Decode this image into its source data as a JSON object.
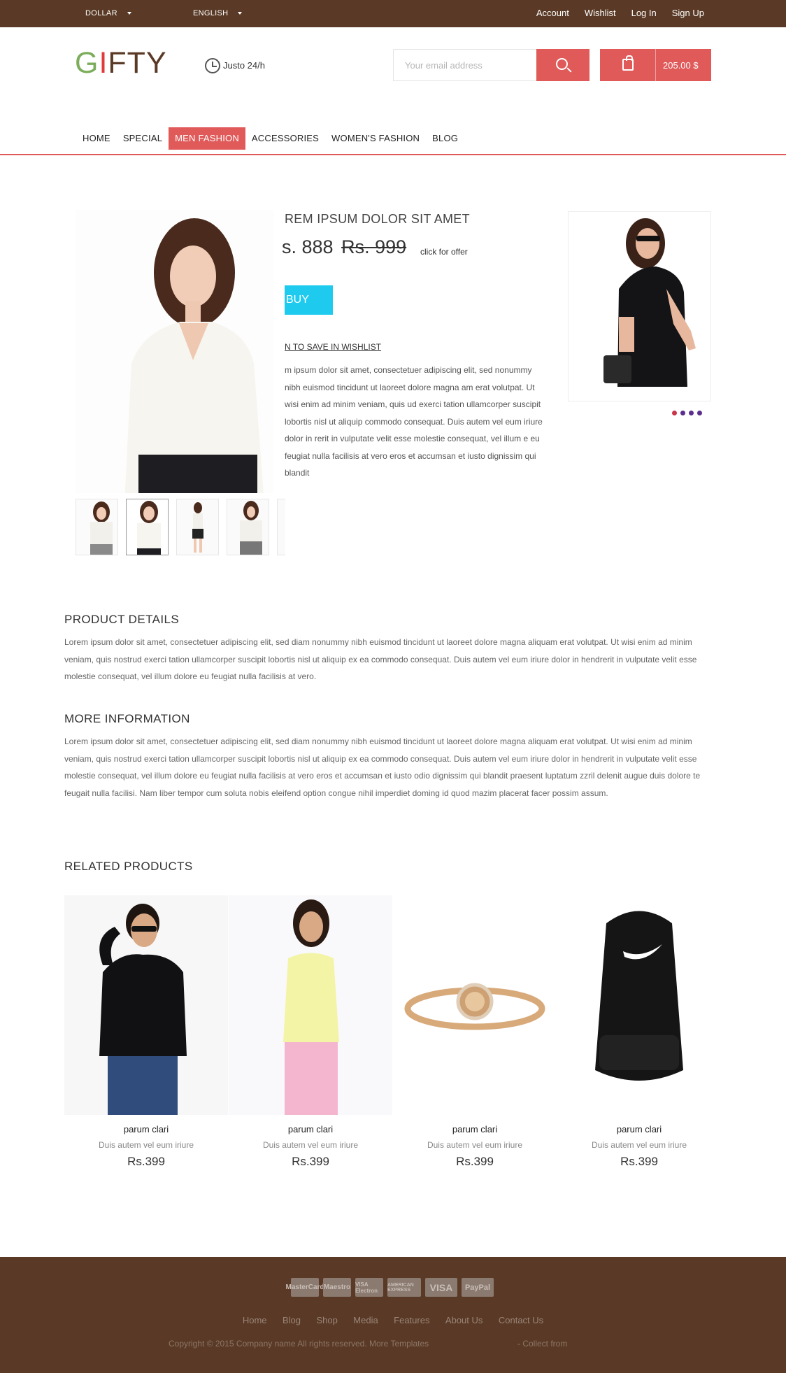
{
  "topbar": {
    "currency": "DOLLAR",
    "language": "ENGLISH",
    "links": [
      "Account",
      "Wishlist",
      "Log In",
      "Sign Up"
    ]
  },
  "header": {
    "logo_g": "G",
    "logo_i": "I",
    "logo_rest": "FTY",
    "support": "Justo 24/h",
    "email_placeholder": "Your email address",
    "cart_total": "205.00 $"
  },
  "nav": [
    "HOME",
    "SPECIAL",
    "MEN FASHION",
    "ACCESSORIES",
    "WOMEN'S FASHION",
    "BLOG"
  ],
  "nav_active": "MEN FASHION",
  "product": {
    "title": "REM IPSUM DOLOR SIT AMET",
    "price": "s. 888",
    "old_price": "Rs. 999",
    "offer": "click for offer",
    "buy": "BUY",
    "wishlist": "N TO SAVE IN WISHLIST",
    "description": "m ipsum dolor sit amet, consectetuer adipiscing elit, sed nonummy nibh euismod tincidunt ut laoreet dolore magna am erat volutpat. Ut wisi enim ad minim veniam, quis ud exerci tation ullamcorper suscipit lobortis nisl ut aliquip commodo consequat. Duis autem vel eum iriure dolor in rerit in vulputate velit esse molestie consequat, vel illum e eu feugiat nulla facilisis at vero eros et accumsan et iusto dignissim qui blandit"
  },
  "carousel_dot_colors": [
    "#c8344a",
    "#5b2d8e",
    "#5b2d8e",
    "#5b2d8e"
  ],
  "details": {
    "title": "PRODUCT DETAILS",
    "text": "Lorem ipsum dolor sit amet, consectetuer adipiscing elit, sed diam nonummy nibh euismod tincidunt ut laoreet dolore magna aliquam erat volutpat. Ut wisi enim ad minim veniam, quis nostrud exerci tation ullamcorper suscipit lobortis nisl ut aliquip ex ea commodo consequat. Duis autem vel eum iriure dolor in hendrerit in vulputate velit esse molestie consequat, vel illum dolore eu feugiat nulla facilisis at vero."
  },
  "more": {
    "title": "MORE INFORMATION",
    "text": "Lorem ipsum dolor sit amet, consectetuer adipiscing elit, sed diam nonummy nibh euismod tincidunt ut laoreet dolore magna aliquam erat volutpat. Ut wisi enim ad minim veniam, quis nostrud exerci tation ullamcorper suscipit lobortis nisl ut aliquip ex ea commodo consequat. Duis autem vel eum iriure dolor in hendrerit in vulputate velit esse molestie consequat, vel illum dolore eu feugiat nulla facilisis at vero eros et accumsan et iusto odio dignissim qui blandit praesent luptatum zzril delenit augue duis dolore te feugait nulla facilisi. Nam liber tempor cum soluta nobis eleifend option congue nihil imperdiet doming id quod mazim placerat facer possim assum."
  },
  "related": {
    "title": "RELATED PRODUCTS",
    "items": [
      {
        "name": "parum clari",
        "sub": "Duis autem vel eum iriure",
        "price": "Rs.399"
      },
      {
        "name": "parum clari",
        "sub": "Duis autem vel eum iriure",
        "price": "Rs.399"
      },
      {
        "name": "parum clari",
        "sub": "Duis autem vel eum iriure",
        "price": "Rs.399"
      },
      {
        "name": "parum clari",
        "sub": "Duis autem vel eum iriure",
        "price": "Rs.399"
      }
    ]
  },
  "footer": {
    "cards": [
      "MasterCard",
      "Maestro",
      "VISA Electron",
      "AMERICAN EXPRESS",
      "VISA",
      "PayPal"
    ],
    "links": [
      "Home",
      "Blog",
      "Shop",
      "Media",
      "Features",
      "About Us",
      "Contact Us"
    ],
    "copyright": "Copyright © 2015 Company name All rights reserved. More Templates",
    "collect": "- Collect from"
  },
  "colors": {
    "brown": "#5a3a26",
    "accent": "#e05a5a",
    "buy": "#1ecbef"
  }
}
